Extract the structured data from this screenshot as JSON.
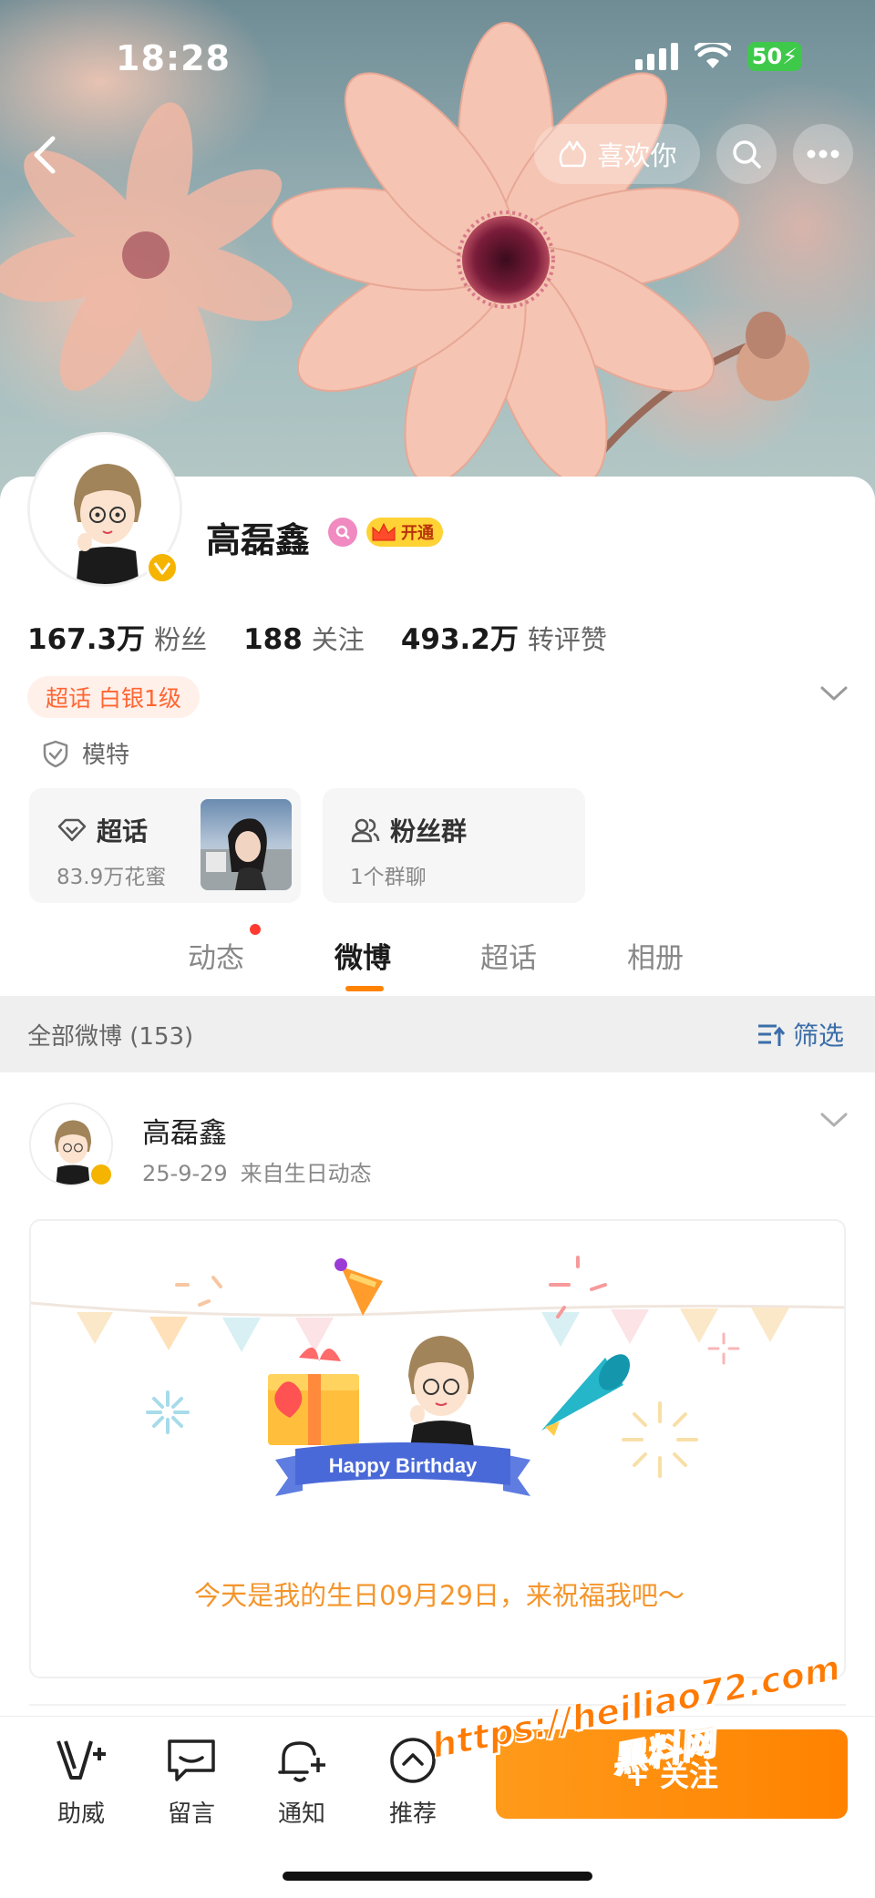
{
  "status_bar": {
    "time": "18:28",
    "battery": "50"
  },
  "header": {
    "like_label": "喜欢你"
  },
  "profile": {
    "name": "高磊鑫",
    "vip_badge": "开通",
    "stats": [
      {
        "value": "167.3万",
        "label": "粉丝"
      },
      {
        "value": "188",
        "label": "关注"
      },
      {
        "value": "493.2万",
        "label": "转评赞"
      }
    ],
    "supertopic_level": "超话 白银1级",
    "occupation": "模特",
    "cards": [
      {
        "title": "超话",
        "subtitle": "83.9万花蜜"
      },
      {
        "title": "粉丝群",
        "subtitle": "1个群聊"
      }
    ]
  },
  "tabs": [
    {
      "label": "动态",
      "active": false,
      "has_dot": true
    },
    {
      "label": "微博",
      "active": true,
      "has_dot": false
    },
    {
      "label": "超话",
      "active": false,
      "has_dot": false
    },
    {
      "label": "相册",
      "active": false,
      "has_dot": false
    }
  ],
  "filter": {
    "all_label": "全部微博 (153)",
    "filter_label": "筛选"
  },
  "post": {
    "author": "高磊鑫",
    "date": "25-9-29",
    "source": "来自生日动态",
    "banner_text": "Happy Birthday",
    "message": "今天是我的生日09月29日，来祝福我吧～"
  },
  "bottom_bar": {
    "items": [
      {
        "label": "助威",
        "icon": "cheer-icon"
      },
      {
        "label": "留言",
        "icon": "message-icon"
      },
      {
        "label": "通知",
        "icon": "bell-plus-icon"
      },
      {
        "label": "推荐",
        "icon": "chevron-up-circle-icon"
      }
    ],
    "follow_label": "+ 关注"
  },
  "watermark": {
    "url": "https://heiliao72.com",
    "name": "黑料网"
  },
  "colors": {
    "accent": "#ff8200",
    "link": "#3b6ea8",
    "tag_text": "#ff6633",
    "gold": "#f5b400"
  }
}
